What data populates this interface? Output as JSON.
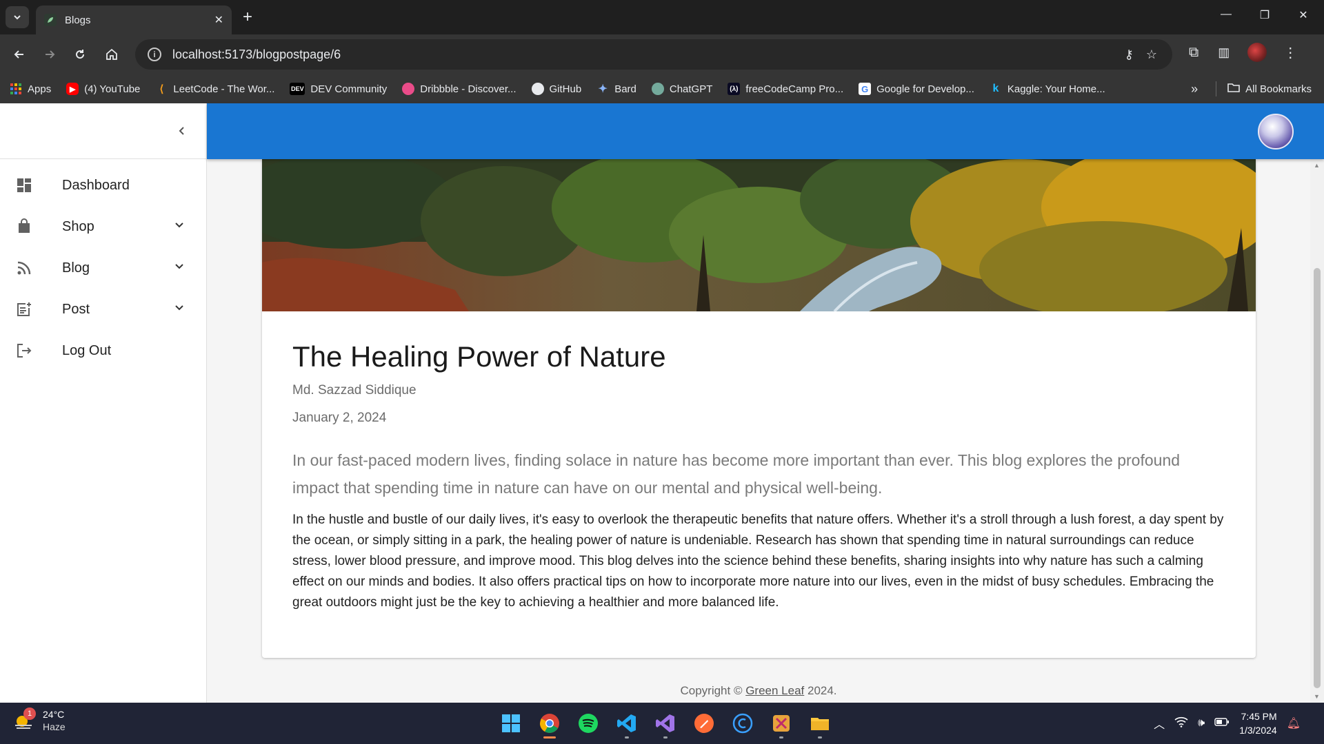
{
  "browser": {
    "tab_title": "Blogs",
    "url": "localhost:5173/blogpostpage/6",
    "new_tab_symbol": "+",
    "bookmarks": [
      {
        "label": "Apps",
        "icon": "apps-icon"
      },
      {
        "label": "(4) YouTube",
        "icon": "youtube-icon"
      },
      {
        "label": "LeetCode - The Wor...",
        "icon": "leetcode-icon"
      },
      {
        "label": "DEV Community",
        "icon": "dev-icon"
      },
      {
        "label": "Dribbble - Discover...",
        "icon": "dribbble-icon"
      },
      {
        "label": "GitHub",
        "icon": "github-icon"
      },
      {
        "label": "Bard",
        "icon": "bard-icon"
      },
      {
        "label": "ChatGPT",
        "icon": "chatgpt-icon"
      },
      {
        "label": "freeCodeCamp Pro...",
        "icon": "freecodecamp-icon"
      },
      {
        "label": "Google for Develop...",
        "icon": "google-icon"
      },
      {
        "label": "Kaggle: Your Home...",
        "icon": "kaggle-icon"
      }
    ],
    "all_bookmarks_label": "All Bookmarks"
  },
  "sidebar": {
    "items": [
      {
        "label": "Dashboard",
        "icon": "dashboard-icon",
        "expandable": false
      },
      {
        "label": "Shop",
        "icon": "shopping-bag-icon",
        "expandable": true
      },
      {
        "label": "Blog",
        "icon": "rss-feed-icon",
        "expandable": true
      },
      {
        "label": "Post",
        "icon": "post-add-icon",
        "expandable": true
      },
      {
        "label": "Log Out",
        "icon": "logout-icon",
        "expandable": false
      }
    ]
  },
  "post": {
    "title": "The Healing Power of Nature",
    "author": "Md. Sazzad Siddique",
    "date": "January 2, 2024",
    "summary": "In our fast-paced modern lives, finding solace in nature has become more important than ever. This blog explores the profound impact that spending time in nature can have on our mental and physical well-being.",
    "body": "In the hustle and bustle of our daily lives, it's easy to overlook the therapeutic benefits that nature offers. Whether it's a stroll through a lush forest, a day spent by the ocean, or simply sitting in a park, the healing power of nature is undeniable. Research has shown that spending time in natural surroundings can reduce stress, lower blood pressure, and improve mood. This blog delves into the science behind these benefits, sharing insights into why nature has such a calming effect on our minds and bodies. It also offers practical tips on how to incorporate more nature into our lives, even in the midst of busy schedules. Embracing the great outdoors might just be the key to achieving a healthier and more balanced life."
  },
  "footer": {
    "prefix": "Copyright © ",
    "link": "Green Leaf",
    "suffix": " 2024."
  },
  "taskbar": {
    "weather_badge": "1",
    "temperature": "24°C",
    "condition": "Haze",
    "time": "7:45 PM",
    "date": "1/3/2024"
  },
  "colors": {
    "appbar": "#1976d2",
    "sidebar_bg": "#ffffff",
    "page_bg": "#f5f5f5"
  }
}
